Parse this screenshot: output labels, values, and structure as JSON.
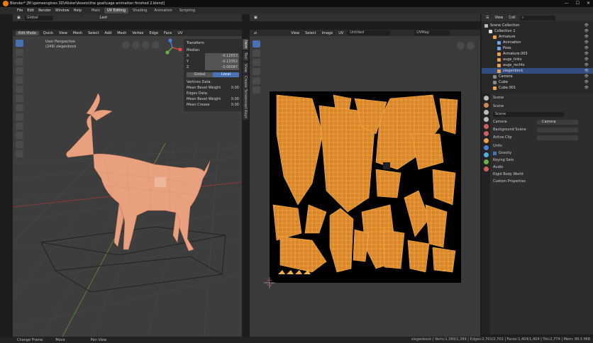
{
  "window": {
    "title": "Blender* [M:\\gameengines 3D\\Alister\\Assets\\the goat\\cage animation finished 2.blend]"
  },
  "menu": [
    "File",
    "Edit",
    "Render",
    "Window",
    "Help"
  ],
  "workspaces": [
    "Main",
    "UV Editing",
    "Shading",
    "Animation",
    "Scripting"
  ],
  "viewport": {
    "mode": "Edit Mode",
    "view_menus": [
      "Quick",
      "View",
      "Mesh",
      "Select",
      "Add",
      "Mesh",
      "Vertex",
      "Edge",
      "Face",
      "UV"
    ],
    "orientation": "Global",
    "overlay_line1": "User Perspective",
    "overlay_line2": "(249) ziegenbock",
    "last_label": "Last"
  },
  "transform_panel": {
    "title": "Transform",
    "median": "Median",
    "x_label": "X",
    "x": "-0.12653",
    "y_label": "Y",
    "y": "-0.12052",
    "z_label": "Z",
    "z": "-0.00087",
    "global": "Global",
    "local": "Local",
    "vertices_data": "Vertices Data:",
    "mean_bevel_weight_label": "Mean Bevel Weight",
    "v_bevel": "0.00",
    "edges_data": "Edges Data:",
    "e_bevel": "0.00",
    "mean_crease_label": "Mean Crease",
    "crease": "0.00"
  },
  "side_tabs": [
    "Item",
    "Tool",
    "View",
    "Create",
    "Screencast Keys"
  ],
  "uv_editor": {
    "menus": [
      "View",
      "Select",
      "Image",
      "UV"
    ],
    "image_name": "Untitled",
    "uvmap": "UVMap"
  },
  "outliner": {
    "view": "View",
    "coll": "Coll",
    "items": [
      {
        "label": "Scene Collection",
        "indent": 0,
        "color": "#bbbbbb"
      },
      {
        "label": "Collection 1",
        "indent": 1,
        "color": "#dddddd"
      },
      {
        "label": "Armature",
        "indent": 2,
        "color": "#e8a24a"
      },
      {
        "label": "Animation",
        "indent": 3,
        "color": "#6ea6e8"
      },
      {
        "label": "Pose",
        "indent": 3,
        "color": "#6ea6e8"
      },
      {
        "label": "Armature.003",
        "indent": 3,
        "color": "#e8a24a"
      },
      {
        "label": "auge_links",
        "indent": 3,
        "color": "#e8a24a"
      },
      {
        "label": "auge_rechts",
        "indent": 3,
        "color": "#e8a24a"
      },
      {
        "label": "ziegenbock",
        "indent": 3,
        "color": "#e8a24a"
      },
      {
        "label": "Camera",
        "indent": 2,
        "color": "#888888"
      },
      {
        "label": "Cube",
        "indent": 2,
        "color": "#888888"
      },
      {
        "label": "Cube.001",
        "indent": 2,
        "color": "#e8a24a"
      }
    ]
  },
  "properties": {
    "header": "Scene",
    "section": "Scene",
    "scene_field": "Scene",
    "camera_label": "Camera",
    "camera_value": "Camera",
    "bg_label": "Background Scene",
    "clip_label": "Active Clip",
    "units": "Units",
    "gravity": "Gravity",
    "keying": "Keying Sets",
    "audio": "Audio",
    "rigid": "Rigid Body World",
    "custom": "Custom Properties"
  },
  "status": {
    "left": [
      "Change Frame",
      "Move",
      "Pan View"
    ],
    "stats": "ziegenbock | Verts:1,389/1,389 | Edges:2,701/2,701 | Faces:1,404/1,404 | Tris:2,774 | Mem: 86.5 MiB"
  }
}
